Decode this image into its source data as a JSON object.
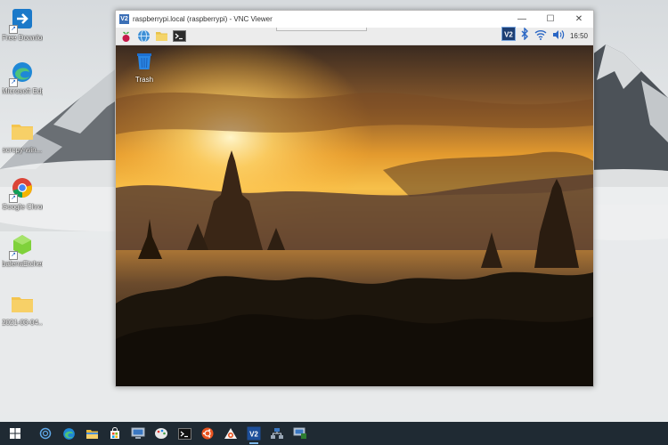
{
  "desktop": {
    "icons": [
      {
        "label": "Free Download...",
        "icon": "download-app-icon"
      },
      {
        "label": "Microsoft Edge",
        "icon": "edge-icon"
      },
      {
        "label": "scrcpy-win...",
        "icon": "folder-icon"
      },
      {
        "label": "Google Chrome",
        "icon": "chrome-icon"
      },
      {
        "label": "balenaEtcher",
        "icon": "balena-etcher-icon"
      },
      {
        "label": "2021-03-04...",
        "icon": "folder-icon"
      }
    ]
  },
  "vnc_window": {
    "title": "raspberrypi.local (raspberrypi) - VNC Viewer",
    "minimize": "—",
    "maximize": "☐",
    "close": "✕",
    "pi_panel": {
      "clock": "16:50",
      "launchers": [
        "raspberry-menu-icon",
        "web-browser-icon",
        "file-manager-icon",
        "terminal-icon"
      ],
      "tray": [
        "vnc-icon",
        "bluetooth-icon",
        "wifi-icon",
        "volume-icon"
      ]
    },
    "remote_desktop": {
      "trash_label": "Trash"
    }
  },
  "taskbar": {
    "items": [
      "windows-start-icon",
      "cortana-icon",
      "edge-icon",
      "file-explorer-icon",
      "store-icon",
      "computer-icon",
      "paint-icon",
      "terminal-icon",
      "ubuntu-icon",
      "ubuntu-app-icon",
      "vnc-viewer-icon",
      "network-icon",
      "remote-desktop-icon"
    ]
  },
  "colors": {
    "taskbar": "#1f2a33",
    "vnc_accent": "#3b6fb6"
  }
}
